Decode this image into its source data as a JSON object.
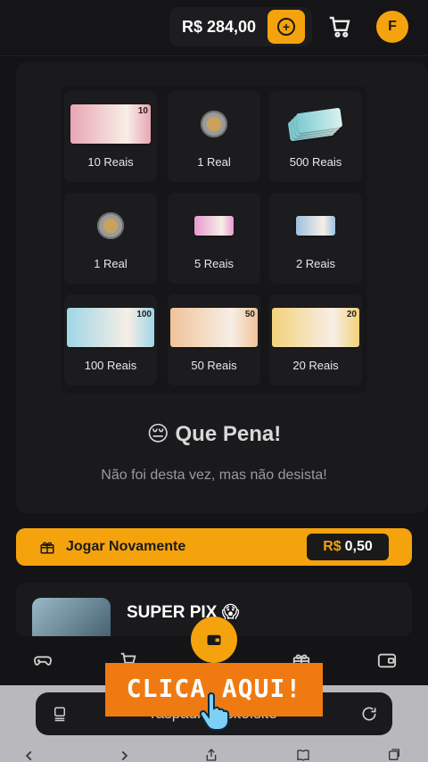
{
  "header": {
    "balance": "R$ 284,00",
    "avatar_initial": "F",
    "icons": [
      "plus-circle-icon",
      "cart-icon"
    ]
  },
  "prizes": [
    {
      "label": "10 Reais",
      "kind": "note",
      "note_value": "10",
      "color": "#e9a6b4"
    },
    {
      "label": "1 Real",
      "kind": "coin"
    },
    {
      "label": "500 Reais",
      "kind": "stack",
      "color": "#7ecbd1"
    },
    {
      "label": "1 Real",
      "kind": "coin"
    },
    {
      "label": "5 Reais",
      "kind": "note",
      "note_value": "5",
      "color": "#e89ad0"
    },
    {
      "label": "2 Reais",
      "kind": "note",
      "note_value": "2",
      "color": "#9cc1e0"
    },
    {
      "label": "100 Reais",
      "kind": "note",
      "note_value": "100",
      "color": "#9fd6e6"
    },
    {
      "label": "50 Reais",
      "kind": "note",
      "note_value": "50",
      "color": "#f0c39a"
    },
    {
      "label": "20 Reais",
      "kind": "note",
      "note_value": "20",
      "color": "#f3d27a"
    }
  ],
  "result": {
    "emoji": "😔",
    "title": "Que Pena!",
    "subtitle": "Não foi desta vez, mas não desista!"
  },
  "play": {
    "label": "Jogar Novamente",
    "currency": "R$",
    "price": "0,50"
  },
  "card": {
    "title": "SUPER PIX 😱"
  },
  "overlay": {
    "text": "CLICA AQUI!"
  },
  "browser": {
    "url": "raspadinhasite.site"
  },
  "colors": {
    "accent": "#f5a30c",
    "background": "#141416",
    "panel": "#1a1a1d",
    "overlay": "#f07a12"
  }
}
